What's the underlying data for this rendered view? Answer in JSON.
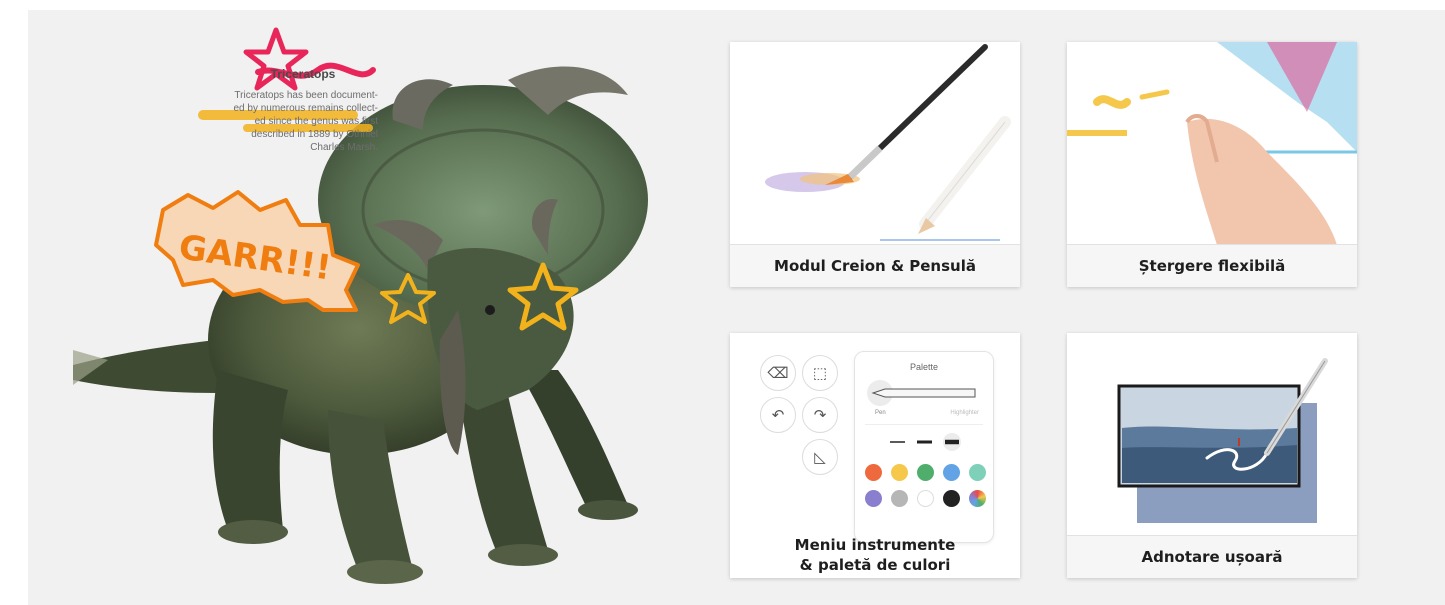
{
  "hero": {
    "note_title": "Triceratops",
    "note_lines": [
      "Triceratops has been document-",
      "ed by numerous remains collect-",
      "ed since the genus was first",
      "described in 1889 by Othniel",
      "Charles Marsh."
    ],
    "scribble_text": "GARR!!!",
    "colors": {
      "orange": "#f07d10",
      "yellow": "#f2b21c",
      "pink": "#e8265a"
    }
  },
  "cards": [
    {
      "caption": "Modul Creion & Pensulă"
    },
    {
      "caption": "Ștergere flexibilă"
    },
    {
      "caption_line1": "Meniu instrumente",
      "caption_line2": "& paletă de culori"
    },
    {
      "caption": "Adnotare ușoară"
    }
  ],
  "palette": {
    "title": "Palette",
    "pen_label": "Pen",
    "secondary_label": "Highlighter",
    "colors": [
      "#ee6a3e",
      "#f5c84c",
      "#4fae6c",
      "#62a3e6",
      "#7fd0b8",
      "#8a7fcf",
      "#b6b6b6",
      "#ffffff",
      "#222222",
      "rainbow"
    ]
  },
  "icons": [
    "eraser-icon",
    "selection-icon",
    "undo-icon",
    "redo-icon",
    "ruler-icon"
  ]
}
